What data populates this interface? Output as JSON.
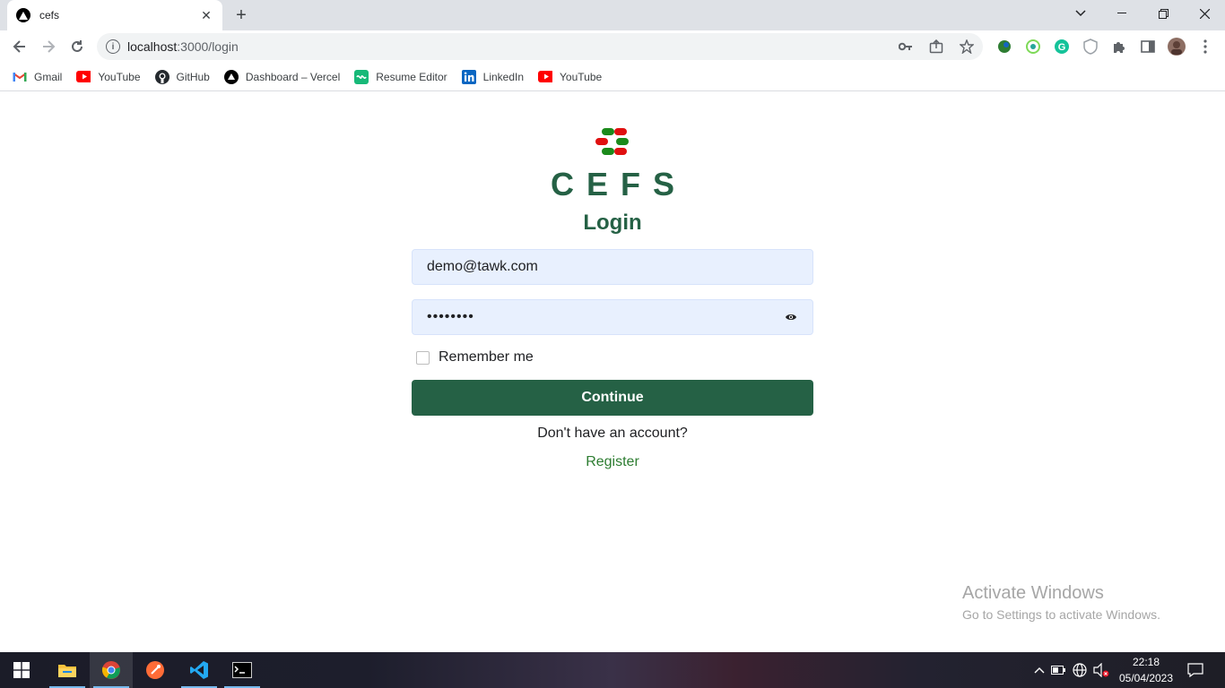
{
  "browser": {
    "tab_title": "cefs",
    "url_host": "localhost",
    "url_path": ":3000/login",
    "bookmarks": [
      {
        "label": "Gmail",
        "icon": "gmail-icon"
      },
      {
        "label": "YouTube",
        "icon": "youtube-icon"
      },
      {
        "label": "GitHub",
        "icon": "github-icon"
      },
      {
        "label": "Dashboard – Vercel",
        "icon": "vercel-icon"
      },
      {
        "label": "Resume Editor",
        "icon": "resume-editor-icon"
      },
      {
        "label": "LinkedIn",
        "icon": "linkedin-icon"
      },
      {
        "label": "YouTube",
        "icon": "youtube-icon"
      }
    ]
  },
  "page": {
    "brand": "CEFS",
    "heading": "Login",
    "email_value": "demo@tawk.com",
    "password_mask": "••••••••",
    "remember_label": "Remember me",
    "continue_label": "Continue",
    "no_account_text": "Don't have an account?",
    "register_label": "Register",
    "colors": {
      "primary": "#256145",
      "link": "#2e7d32",
      "field_bg": "#e8f0fe"
    }
  },
  "watermark": {
    "title": "Activate Windows",
    "subtitle": "Go to Settings to activate Windows."
  },
  "taskbar": {
    "time": "22:18",
    "date": "05/04/2023"
  }
}
